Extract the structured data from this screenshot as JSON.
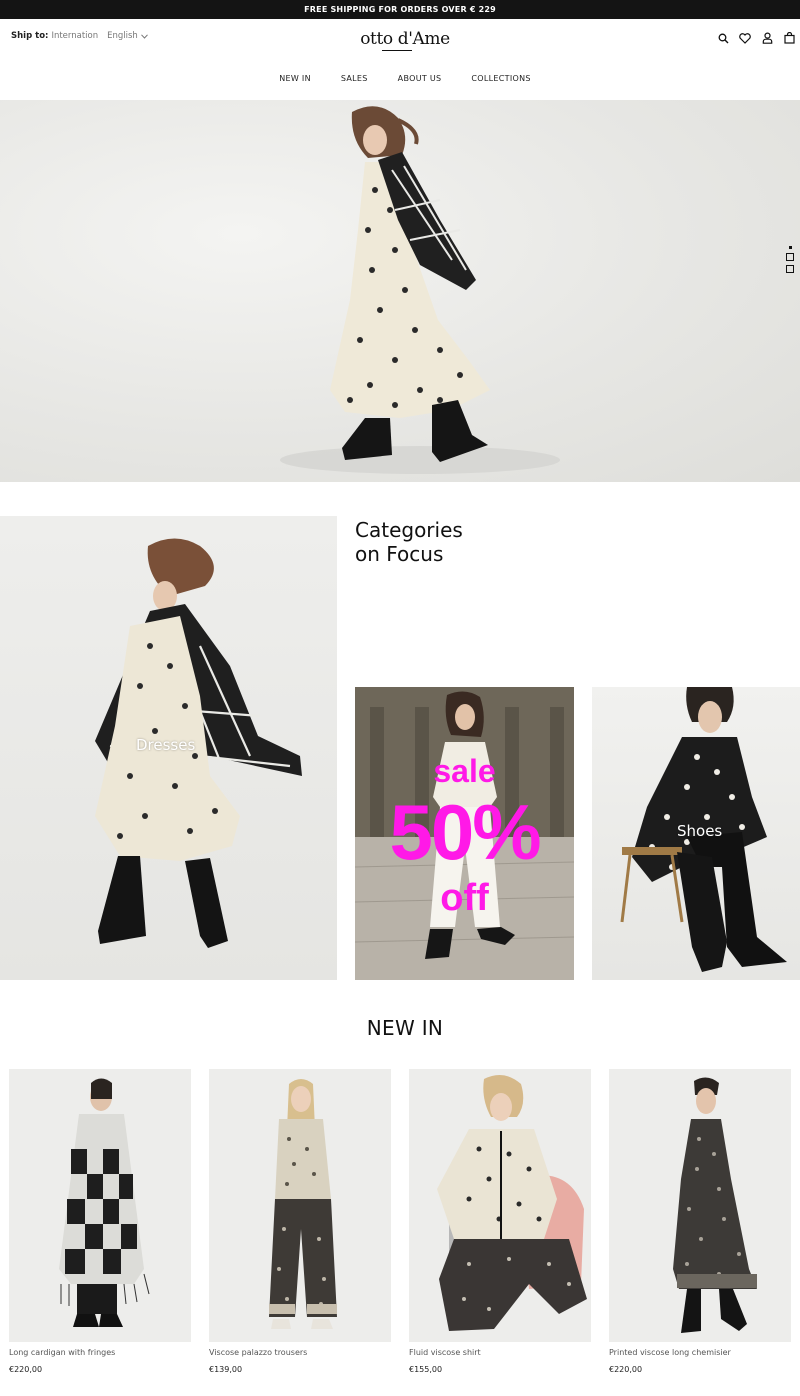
{
  "topbar": {
    "text": "FREE SHIPPING FOR ORDERS OVER € 229"
  },
  "header": {
    "ship_label": "Ship to:",
    "ship_value": "Internation",
    "language": "English",
    "logo": "otto d'Ame"
  },
  "nav": {
    "items": [
      {
        "label": "NEW IN"
      },
      {
        "label": "SALES"
      },
      {
        "label": "ABOUT US"
      },
      {
        "label": "COLLECTIONS"
      }
    ]
  },
  "hero": {
    "slide_count": 3,
    "active_slide": 1
  },
  "categories": {
    "title_line1": "Categories",
    "title_line2": "on Focus",
    "dresses_label": "Dresses",
    "sale_word": "sale",
    "sale_percent": "50%",
    "sale_off": "off",
    "shoes_label": "Shoes",
    "sale_color": "#ff19e7"
  },
  "new_in": {
    "title": "NEW IN",
    "products": [
      {
        "name": "Long cardigan with fringes",
        "price": "€220,00"
      },
      {
        "name": "Viscose palazzo trousers",
        "price": "€139,00"
      },
      {
        "name": "Fluid viscose shirt",
        "price": "€155,00"
      },
      {
        "name": "Printed viscose long chemisier",
        "price": "€220,00"
      }
    ]
  }
}
